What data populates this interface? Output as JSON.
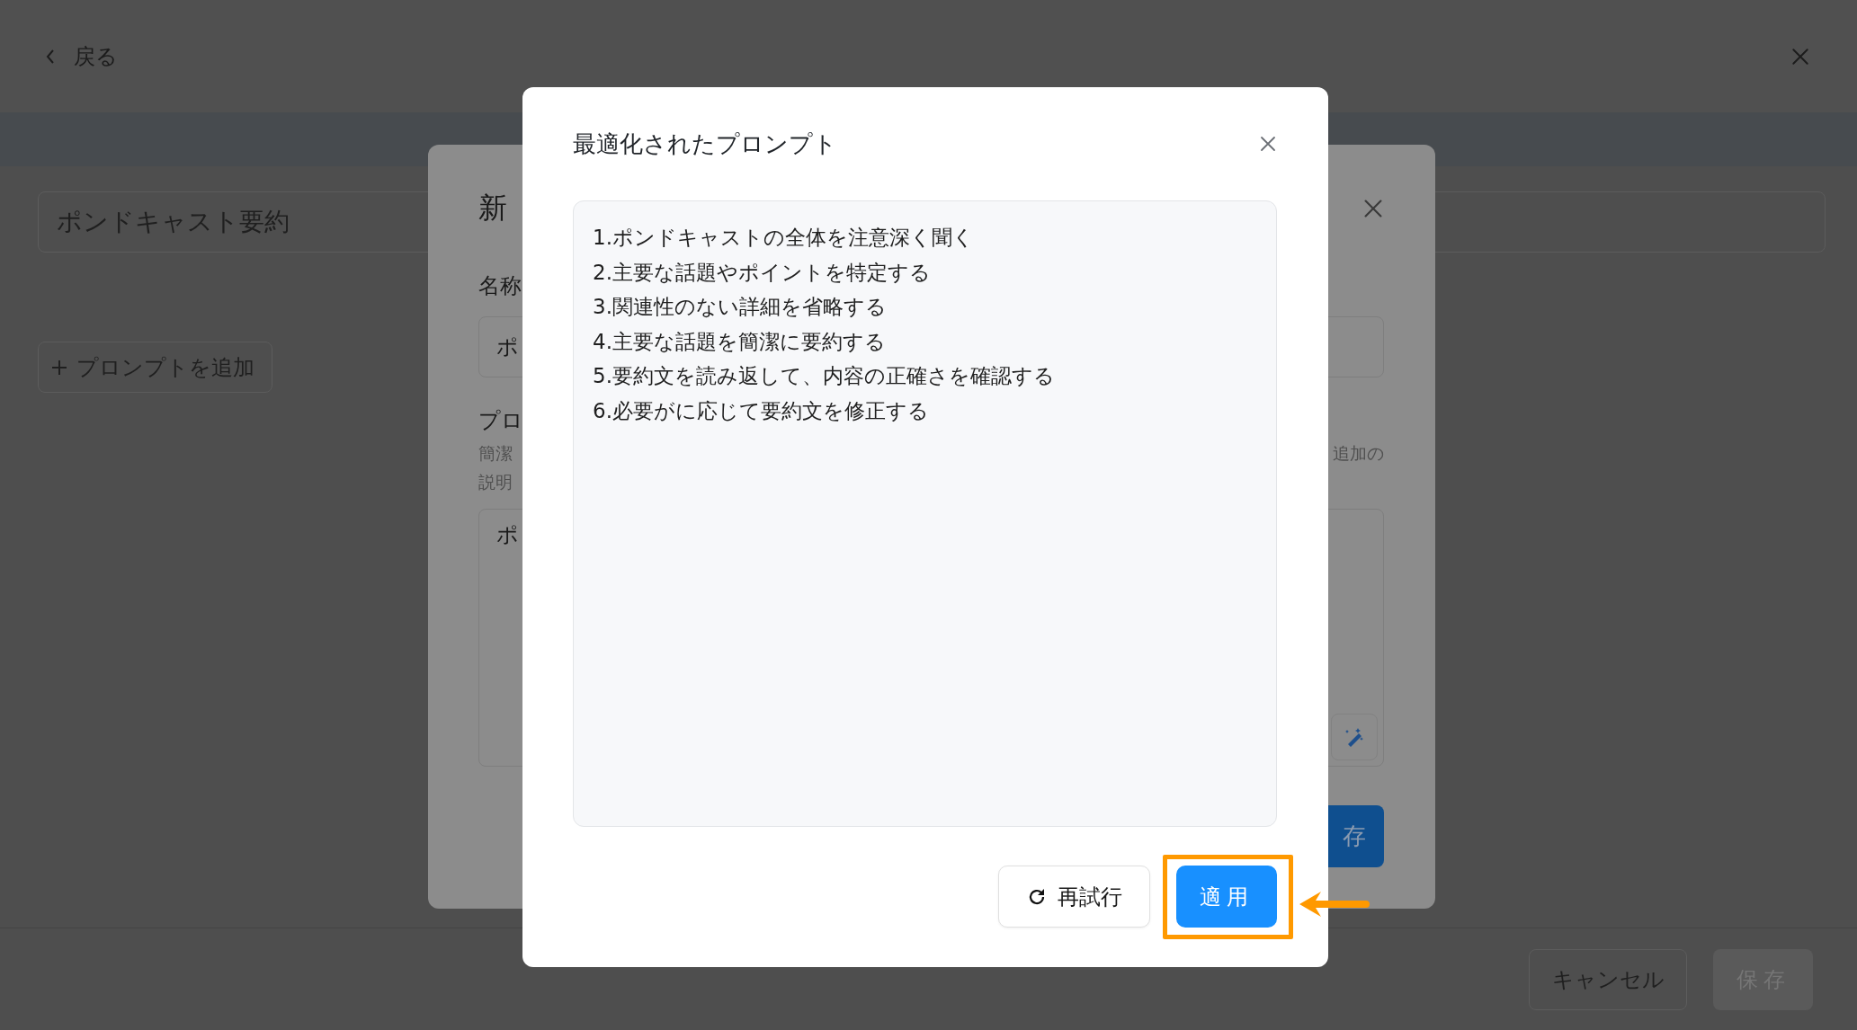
{
  "top_bar": {
    "back_label": "戻る"
  },
  "main": {
    "title_field": {
      "value": "ポンドキャスト要約"
    },
    "add_prompt_button": "プロンプトを追加"
  },
  "footer": {
    "cancel_button": "キャンセル",
    "save_button": {
      "label": "保存",
      "disabled": true
    }
  },
  "edit_dialog": {
    "title": "新",
    "name_label": "名称",
    "name_value": "ポ",
    "prompt_label": "プロ",
    "description_left": [
      "簡潔",
      "説明"
    ],
    "description_right": "追加の",
    "prompt_value": "ポ",
    "save_button": "存"
  },
  "optimized_dialog": {
    "title": "最適化されたプロンプト",
    "lines": [
      "1.ポンドキャストの全体を注意深く聞く",
      "2.主要な話題やポイントを特定する",
      "3.関連性のない詳細を省略する",
      "4.主要な話題を簡潔に要約する",
      "5.要約文を読み返して、内容の正確さを確認する",
      "6.必要がに応じて要約文を修正する"
    ],
    "retry_button": "再試行",
    "apply_button": "適用"
  }
}
